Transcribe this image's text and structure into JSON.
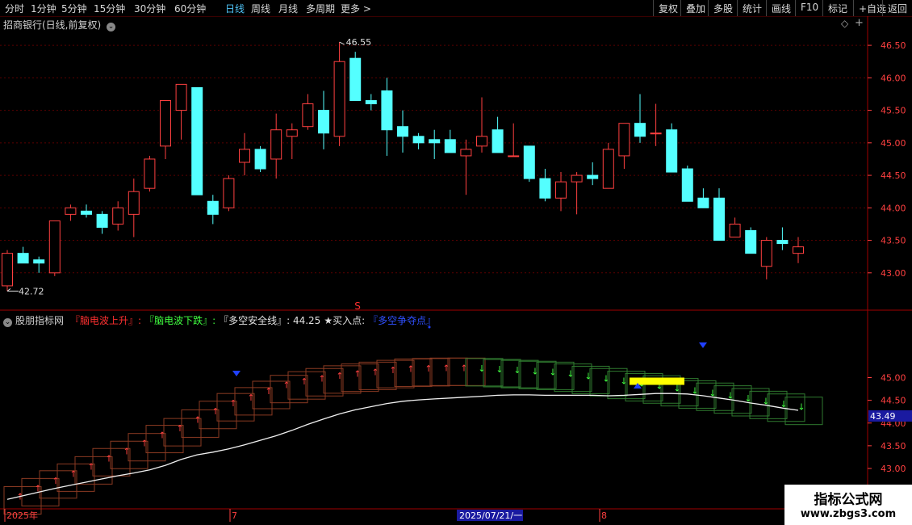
{
  "toolbar": {
    "periods": [
      "分时",
      "1分钟",
      "5分钟",
      "15分钟",
      "30分钟",
      "60分钟",
      "日线",
      "周线",
      "月线",
      "多周期",
      "更多 >"
    ],
    "active_period": "日线",
    "right_buttons": [
      "复权",
      "叠加",
      "多股",
      "统计",
      "画线",
      "F10",
      "标记",
      "+自选",
      "返回"
    ]
  },
  "main_panel": {
    "title": "招商银行(日线,前复权)",
    "high_label": "46.55",
    "low_label": "42.72",
    "signal_mark": "S"
  },
  "sub_panel": {
    "name": "股朋指标网",
    "legend": [
      {
        "text": "『脑电波上升』:",
        "color": "#ff3030"
      },
      {
        "text": "『脑电波下跌』:",
        "color": "#40ff40"
      },
      {
        "text": "『多空安全线』: 44.25",
        "color": "#e0e0e0"
      },
      {
        "text": "★买入点:",
        "color": "#e0e0e0"
      },
      {
        "text": "『多空争夺点』",
        "color": "#3050ff"
      }
    ],
    "current_value_tag": "43.49"
  },
  "date_axis": [
    "2025年",
    "7",
    "2025/07/21/一",
    "8"
  ],
  "brand": {
    "line1": "指标公式网",
    "line2": "www.zbgs3.com"
  },
  "colors": {
    "up": "#ff4040",
    "down": "#54ffff",
    "grid": "#5a0000",
    "axis": "#ff4040"
  },
  "chart_data": [
    {
      "type": "candlestick",
      "ylim": [
        42.6,
        46.7
      ],
      "yticks": [
        43.0,
        43.5,
        44.0,
        44.5,
        45.0,
        45.5,
        46.0,
        46.5
      ],
      "candles": [
        [
          42.8,
          43.35,
          42.72,
          43.3
        ],
        [
          43.3,
          43.4,
          43.15,
          43.15
        ],
        [
          43.2,
          43.25,
          43.0,
          43.15
        ],
        [
          43.0,
          43.8,
          42.95,
          43.8
        ],
        [
          43.9,
          44.05,
          43.8,
          44.0
        ],
        [
          43.95,
          44.05,
          43.85,
          43.9
        ],
        [
          43.9,
          43.95,
          43.6,
          43.7
        ],
        [
          43.75,
          44.1,
          43.65,
          44.0
        ],
        [
          43.9,
          44.45,
          43.55,
          44.25
        ],
        [
          44.3,
          44.8,
          44.25,
          44.75
        ],
        [
          44.95,
          45.55,
          44.75,
          45.65
        ],
        [
          45.5,
          45.9,
          45.05,
          45.9
        ],
        [
          45.85,
          45.85,
          44.2,
          44.2
        ],
        [
          44.1,
          44.2,
          43.75,
          43.9
        ],
        [
          44.0,
          44.5,
          43.95,
          44.45
        ],
        [
          44.7,
          45.15,
          44.5,
          44.9
        ],
        [
          44.9,
          44.95,
          44.55,
          44.6
        ],
        [
          44.75,
          45.45,
          44.45,
          45.2
        ],
        [
          45.1,
          45.3,
          44.75,
          45.2
        ],
        [
          45.25,
          45.75,
          45.2,
          45.6
        ],
        [
          45.5,
          45.8,
          44.9,
          45.15
        ],
        [
          45.1,
          46.55,
          44.95,
          46.25
        ],
        [
          46.3,
          46.4,
          45.65,
          45.65
        ],
        [
          45.65,
          45.75,
          45.5,
          45.6
        ],
        [
          45.8,
          46.0,
          44.8,
          45.2
        ],
        [
          45.25,
          45.5,
          44.85,
          45.1
        ],
        [
          45.1,
          45.15,
          44.9,
          45.0
        ],
        [
          45.05,
          45.2,
          44.75,
          45.0
        ],
        [
          45.05,
          45.2,
          44.85,
          44.85
        ],
        [
          44.8,
          45.05,
          44.2,
          44.9
        ],
        [
          44.95,
          45.7,
          44.85,
          45.1
        ],
        [
          45.2,
          45.4,
          44.85,
          44.85
        ],
        [
          44.8,
          45.3,
          44.8,
          44.8
        ],
        [
          44.95,
          44.95,
          44.4,
          44.45
        ],
        [
          44.45,
          44.6,
          44.1,
          44.15
        ],
        [
          44.15,
          44.55,
          43.95,
          44.4
        ],
        [
          44.4,
          44.55,
          43.9,
          44.5
        ],
        [
          44.5,
          44.7,
          44.35,
          44.45
        ],
        [
          44.3,
          45.0,
          44.3,
          44.9
        ],
        [
          44.8,
          45.3,
          44.6,
          45.3
        ],
        [
          45.3,
          45.75,
          45.0,
          45.1
        ],
        [
          45.15,
          45.6,
          44.95,
          45.15
        ],
        [
          45.2,
          45.3,
          44.55,
          44.55
        ],
        [
          44.6,
          44.65,
          44.1,
          44.1
        ],
        [
          44.15,
          44.3,
          44.0,
          44.0
        ],
        [
          44.15,
          44.3,
          43.5,
          43.5
        ],
        [
          43.55,
          43.85,
          43.55,
          43.75
        ],
        [
          43.65,
          43.7,
          43.3,
          43.3
        ],
        [
          43.1,
          43.55,
          42.9,
          43.5
        ],
        [
          43.5,
          43.7,
          43.35,
          43.45
        ],
        [
          43.3,
          43.55,
          43.15,
          43.4
        ]
      ]
    },
    {
      "type": "line",
      "ylim": [
        42.2,
        46.2
      ],
      "yticks": [
        42.5,
        43.0,
        43.5,
        44.0,
        44.5,
        45.0
      ],
      "series": [
        {
          "values": [
            42.32,
            42.4,
            42.48,
            42.56,
            42.63,
            42.7,
            42.77,
            42.84,
            42.9,
            42.97,
            43.07,
            43.2,
            43.3,
            43.36,
            43.43,
            43.52,
            43.62,
            43.72,
            43.84,
            43.97,
            44.09,
            44.2,
            44.29,
            44.36,
            44.43,
            44.48,
            44.51,
            44.53,
            44.55,
            44.57,
            44.59,
            44.61,
            44.62,
            44.62,
            44.61,
            44.61,
            44.61,
            44.61,
            44.6,
            44.61,
            44.63,
            44.65,
            44.65,
            44.64,
            44.6,
            44.55,
            44.5,
            44.44,
            44.39,
            44.33,
            44.28
          ]
        },
        {
          "values": [
            42.6,
            42.78,
            42.95,
            43.1,
            43.26,
            43.44,
            43.6,
            43.77,
            43.95,
            44.1,
            44.29,
            44.48,
            44.65,
            44.78,
            44.92,
            45.05,
            45.13,
            45.2,
            45.26,
            45.3,
            45.34,
            45.38,
            45.41,
            45.42,
            45.43,
            45.43,
            45.42,
            45.4,
            45.38,
            45.36,
            45.34,
            45.3,
            45.25,
            45.2,
            45.14,
            45.09,
            45.04,
            44.98,
            44.93,
            44.88,
            44.82,
            44.76,
            44.7,
            44.64,
            44.57
          ]
        }
      ]
    }
  ]
}
